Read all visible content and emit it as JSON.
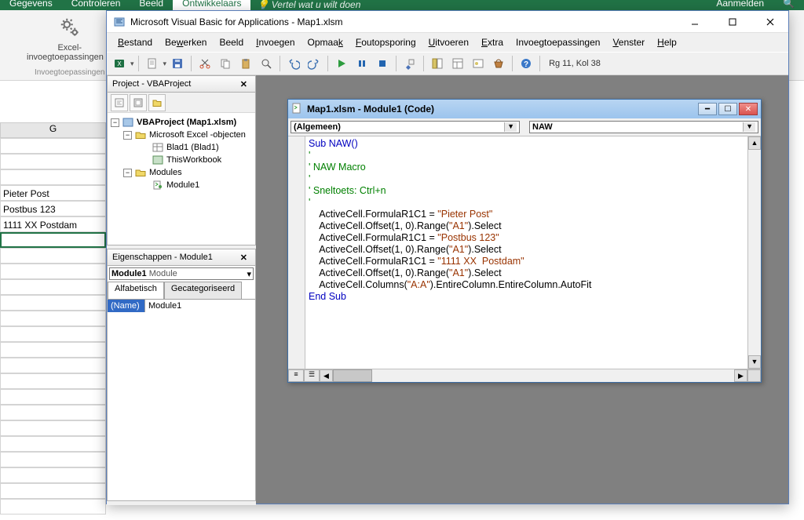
{
  "excel": {
    "tabs": [
      "Gegevens",
      "Controleren",
      "Beeld",
      "Ontwikkelaars"
    ],
    "active_tab": "Ontwikkelaars",
    "tell_me": "Vertel wat u wilt doen",
    "signin": "Aanmelden",
    "tool_excel_addins_1": "Excel-",
    "tool_excel_addins_2": "invoegtoepassingen in",
    "group_addins": "Invoegtoepassingen",
    "col_header": "G",
    "cells": [
      "",
      "",
      "",
      "Pieter Post",
      "Postbus 123",
      "1111 XX  Postdam",
      ""
    ]
  },
  "vba": {
    "title": "Microsoft Visual Basic for Applications - Map1.xlsm",
    "menu": [
      {
        "text": "Bestand",
        "u": "B"
      },
      {
        "text": "Bewerken",
        "u": "w"
      },
      {
        "text": "Beeld",
        "u": ""
      },
      {
        "text": "Invoegen",
        "u": "I"
      },
      {
        "text": "Opmaak",
        "u": "k"
      },
      {
        "text": "Foutopsporing",
        "u": "F"
      },
      {
        "text": "Uitvoeren",
        "u": "U"
      },
      {
        "text": "Extra",
        "u": "E"
      },
      {
        "text": "Invoegtoepassingen",
        "u": ""
      },
      {
        "text": "Venster",
        "u": "V"
      },
      {
        "text": "Help",
        "u": "H"
      }
    ],
    "location": "Rg 11, Kol 38",
    "project_pane_title": "Project - VBAProject",
    "tree": {
      "root": "VBAProject (Map1.xlsm)",
      "excel_objects": "Microsoft Excel -objecten",
      "sheet": "Blad1 (Blad1)",
      "workbook": "ThisWorkbook",
      "modules": "Modules",
      "module1": "Module1"
    },
    "props_pane_title": "Eigenschappen - Module1",
    "props_dropdown": "Module1 Module",
    "props_tab_alpha": "Alfabetisch",
    "props_tab_cat": "Gecategoriseerd",
    "props_name_key": "(Name)",
    "props_name_val": "Module1"
  },
  "code_window": {
    "title": "Map1.xlsm - Module1 (Code)",
    "dd_left": "(Algemeen)",
    "dd_right": "NAW",
    "lines": [
      {
        "type": "blue",
        "text": "Sub NAW()"
      },
      {
        "type": "green",
        "text": "'"
      },
      {
        "type": "green",
        "text": "' NAW Macro"
      },
      {
        "type": "green",
        "text": "'"
      },
      {
        "type": "green",
        "text": "' Sneltoets: Ctrl+n"
      },
      {
        "type": "green",
        "text": "'"
      },
      {
        "type": "code",
        "text": "    ActiveCell.FormulaR1C1 = \"Pieter Post\""
      },
      {
        "type": "code",
        "text": "    ActiveCell.Offset(1, 0).Range(\"A1\").Select"
      },
      {
        "type": "code",
        "text": "    ActiveCell.FormulaR1C1 = \"Postbus 123\""
      },
      {
        "type": "code",
        "text": "    ActiveCell.Offset(1, 0).Range(\"A1\").Select"
      },
      {
        "type": "code",
        "text": "    ActiveCell.FormulaR1C1 = \"1111 XX  Postdam\""
      },
      {
        "type": "code",
        "text": "    ActiveCell.Offset(1, 0).Range(\"A1\").Select"
      },
      {
        "type": "code",
        "text": "    ActiveCell.Columns(\"A:A\").EntireColumn.EntireColumn.AutoFit"
      },
      {
        "type": "blue",
        "text": "End Sub"
      }
    ]
  }
}
